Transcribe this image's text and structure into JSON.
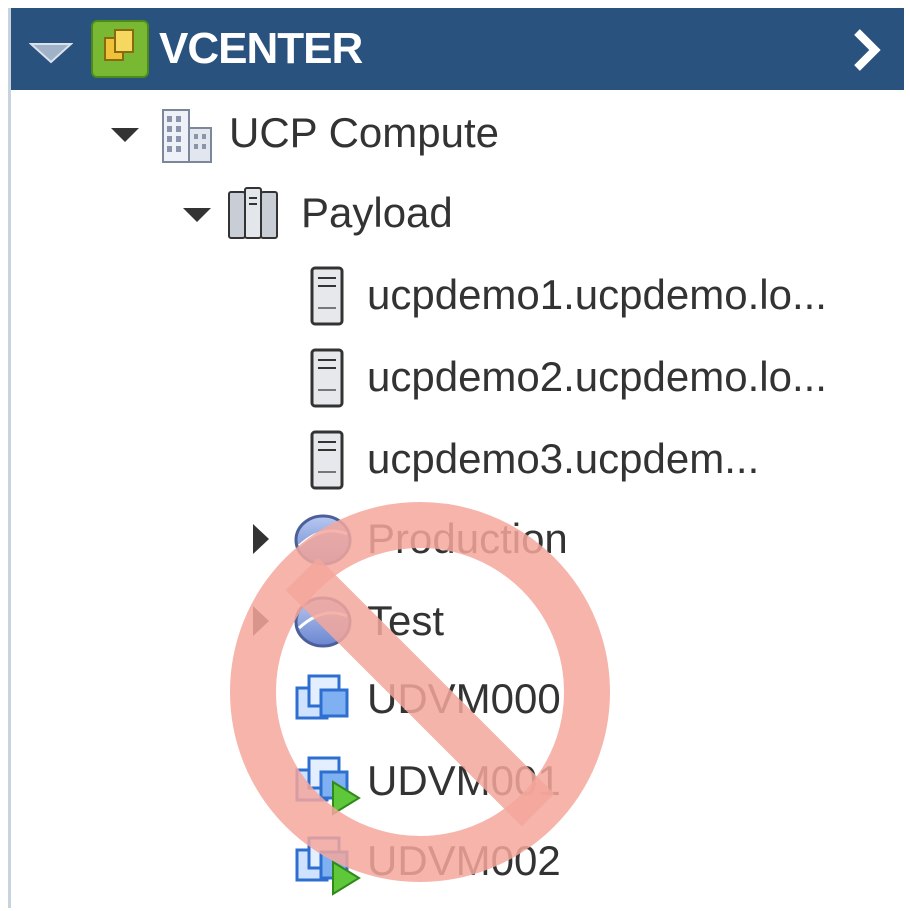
{
  "header": {
    "title": "VCENTER"
  },
  "tree": {
    "datacenter": "UCP Compute",
    "cluster": "Payload",
    "hosts": [
      "ucpdemo1.ucpdemo.lo...",
      "ucpdemo2.ucpdemo.lo...",
      "ucpdemo3.ucpdem..."
    ],
    "pools": [
      "Production",
      "Test"
    ],
    "vms": [
      "UDVM000",
      "UDVM001",
      "UDVM002"
    ]
  },
  "colors": {
    "header_bg": "#29527f",
    "text": "#333333",
    "no_symbol": "#f4a79c"
  },
  "icons": {
    "header": [
      "caret-down-icon",
      "vcenter-logo-icon",
      "chevron-right-icon"
    ],
    "datacenter": "datacenter-building-icon",
    "cluster": "cluster-servers-icon",
    "host": "host-server-icon",
    "pool": "resource-pool-icon",
    "vm": "vm-icon",
    "vm_running": "vm-running-icon",
    "overlay": "no-symbol-icon"
  }
}
